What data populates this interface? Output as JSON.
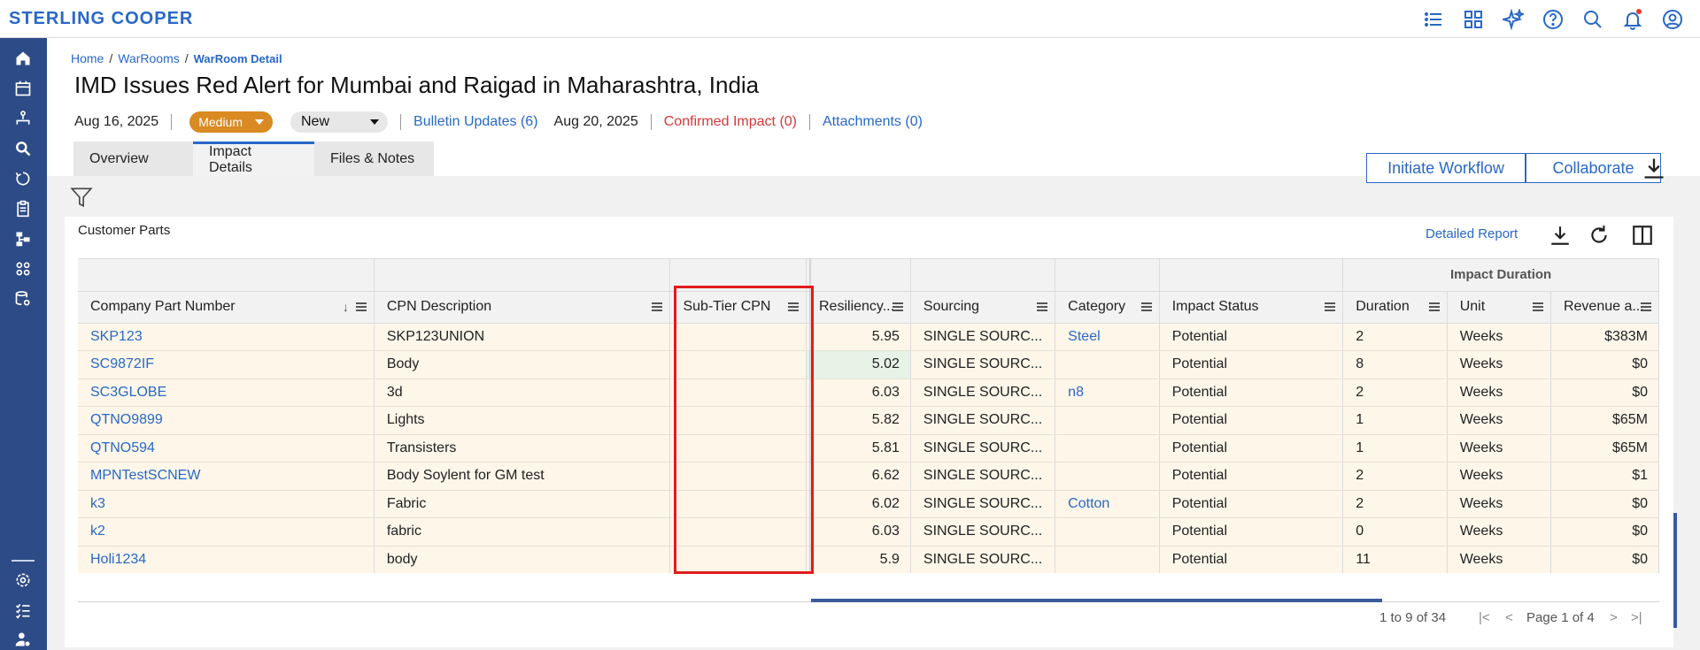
{
  "brand": "STERLING COOPER",
  "breadcrumb": {
    "home": "Home",
    "warrooms": "WarRooms",
    "current": "WarRoom Detail",
    "sep": "/"
  },
  "title": "IMD Issues Red Alert for Mumbai and Raigad in Maharashtra, India",
  "meta": {
    "date": "Aug 16, 2025",
    "severity": "Medium",
    "status": "New",
    "bulletin": "Bulletin Updates (6)",
    "bulletin_date": "Aug 20, 2025",
    "confirmed": "Confirmed Impact (0)",
    "attachments": "Attachments (0)"
  },
  "tabs": [
    {
      "label": "Overview"
    },
    {
      "label": "Impact Details"
    },
    {
      "label": "Files & Notes"
    }
  ],
  "buttons": {
    "initiate": "Initiate Workflow",
    "collaborate": "Collaborate"
  },
  "card": {
    "title": "Customer Parts",
    "detailed_report": "Detailed Report"
  },
  "grid": {
    "group_header": "Impact Duration",
    "columns": [
      "Company Part Number",
      "CPN Description",
      "Sub-Tier CPN",
      "Resiliency...",
      "Sourcing",
      "Category",
      "Impact Status",
      "Duration",
      "Unit",
      "Revenue a..."
    ],
    "sort_indicator": "↓",
    "rows": [
      {
        "cpn": "SKP123",
        "desc": "SKP123UNION",
        "sub": "",
        "res": "5.95",
        "src": "SINGLE SOURC...",
        "cat": "Steel",
        "status": "Potential",
        "dur": "2",
        "unit": "Weeks",
        "rev": "$383M"
      },
      {
        "cpn": "SC9872IF",
        "desc": "Body",
        "sub": "",
        "res": "5.02",
        "src": "SINGLE SOURC...",
        "cat": "",
        "status": "Potential",
        "dur": "8",
        "unit": "Weeks",
        "rev": "$0"
      },
      {
        "cpn": "SC3GLOBE",
        "desc": "3d",
        "sub": "",
        "res": "6.03",
        "src": "SINGLE SOURC...",
        "cat": "n8",
        "status": "Potential",
        "dur": "2",
        "unit": "Weeks",
        "rev": "$0"
      },
      {
        "cpn": "QTNO9899",
        "desc": "Lights",
        "sub": "",
        "res": "5.82",
        "src": "SINGLE SOURC...",
        "cat": "",
        "status": "Potential",
        "dur": "1",
        "unit": "Weeks",
        "rev": "$65M"
      },
      {
        "cpn": "QTNO594",
        "desc": "Transisters",
        "sub": "",
        "res": "5.81",
        "src": "SINGLE SOURC...",
        "cat": "",
        "status": "Potential",
        "dur": "1",
        "unit": "Weeks",
        "rev": "$65M"
      },
      {
        "cpn": "MPNTestSCNEW",
        "desc": "Body Soylent for GM test",
        "sub": "",
        "res": "6.62",
        "src": "SINGLE SOURC...",
        "cat": "",
        "status": "Potential",
        "dur": "2",
        "unit": "Weeks",
        "rev": "$1"
      },
      {
        "cpn": "k3",
        "desc": "Fabric",
        "sub": "",
        "res": "6.02",
        "src": "SINGLE SOURC...",
        "cat": "Cotton",
        "status": "Potential",
        "dur": "2",
        "unit": "Weeks",
        "rev": "$0"
      },
      {
        "cpn": "k2",
        "desc": "fabric",
        "sub": "",
        "res": "6.03",
        "src": "SINGLE SOURC...",
        "cat": "",
        "status": "Potential",
        "dur": "0",
        "unit": "Weeks",
        "rev": "$0"
      },
      {
        "cpn": "Holi1234",
        "desc": "body",
        "sub": "",
        "res": "5.9",
        "src": "SINGLE SOURC...",
        "cat": "",
        "status": "Potential",
        "dur": "11",
        "unit": "Weeks",
        "rev": "$0"
      }
    ]
  },
  "pager": {
    "range": "1 to 9 of 34",
    "page": "Page 1 of 4",
    "first": "|<",
    "prev": "<",
    "next": ">",
    "last": ">|"
  },
  "colors": {
    "brand": "#2868c7",
    "rail": "#2d4b86",
    "highlight": "#e21b1b",
    "medium": "#d98a22"
  }
}
